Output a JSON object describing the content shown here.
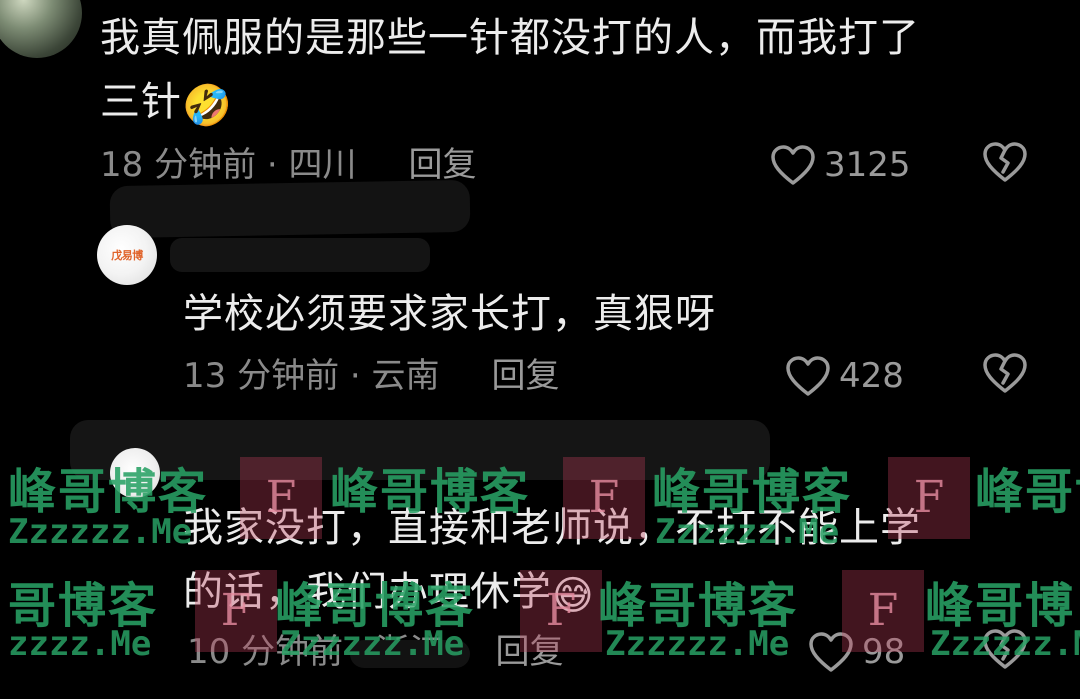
{
  "comments": [
    {
      "text_lines": [
        "我真佩服的是那些一针都没打的人，而我打了",
        "三针"
      ],
      "emoji": "🤣",
      "time": "18 分钟前 · 四川",
      "reply": "回复",
      "likes": "3125"
    },
    {
      "avatar_mark": "戊易博",
      "text_lines": [
        "学校必须要求家长打，真狠呀"
      ],
      "time": "13 分钟前 · 云南",
      "reply": "回复",
      "likes": "428"
    },
    {
      "text_lines": [
        "我家没打，直接和老师说，不打不能上学",
        "的话，我们办理休学"
      ],
      "emoji": "😅",
      "time": "10 分钟前 · 浙江",
      "reply": "回复",
      "likes": "98"
    }
  ],
  "watermark": {
    "cn_full": "峰哥博客",
    "cn_partial_a": "哥博客",
    "cn_partial_b": "峰哥博",
    "en_full": "Zzzzzz.Me",
    "en_partial": "zzzz.Me",
    "box_letter": "F"
  },
  "colors": {
    "background": "#000000",
    "text": "#ececec",
    "meta": "#8a8a8a",
    "watermark": "#28a064"
  },
  "icons": {
    "like": "heart-outline-icon",
    "dislike": "broken-heart-icon"
  }
}
